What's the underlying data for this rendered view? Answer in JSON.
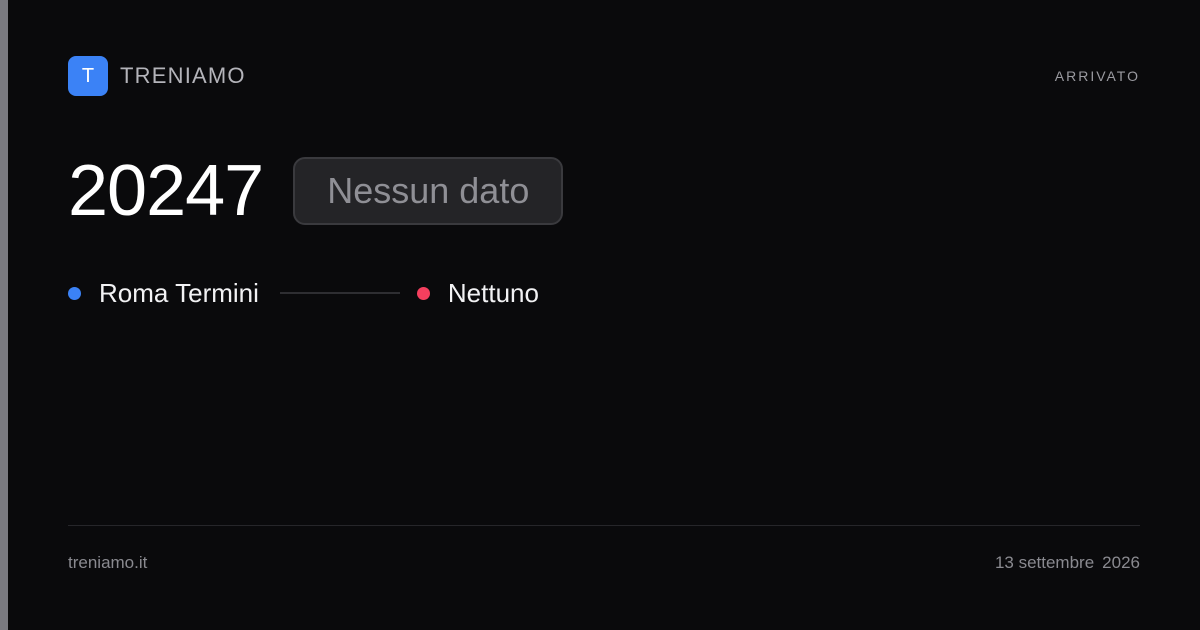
{
  "brand": {
    "logo_letter": "T",
    "name": "TRENIAMO",
    "accent_color": "#3b82f6"
  },
  "status": "ARRIVATO",
  "train": {
    "number": "20247",
    "delay_text": "Nessun dato"
  },
  "route": {
    "origin": "Roma Termini",
    "destination": "Nettuno",
    "origin_color": "#3b82f6",
    "destination_color": "#f43f5e"
  },
  "footer": {
    "site": "treniamo.it",
    "date_day_month": "13 settembre",
    "date_year": "2026"
  }
}
